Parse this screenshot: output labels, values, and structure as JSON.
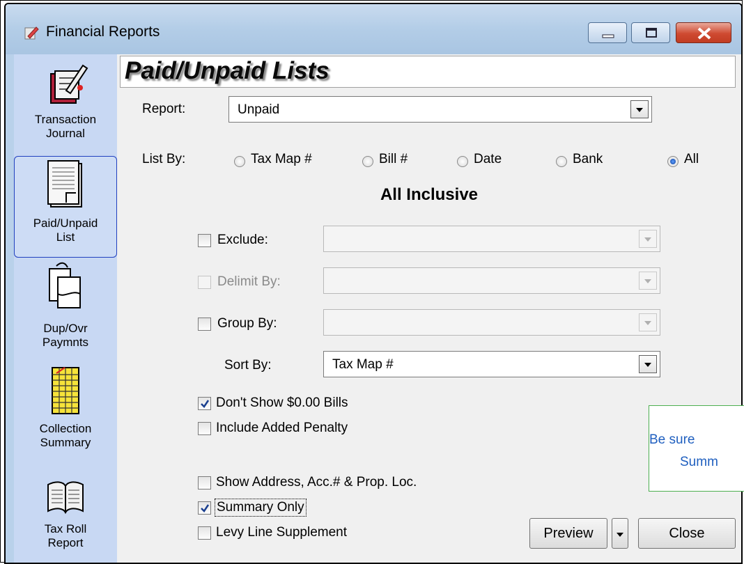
{
  "window": {
    "title": "Financial Reports",
    "controls": [
      "minimize",
      "maximize",
      "close"
    ]
  },
  "sidebar": {
    "items": [
      {
        "label_line1": "Transaction",
        "label_line2": "Journal",
        "icon": "journal-book-icon",
        "selected": false
      },
      {
        "label_line1": "Paid/Unpaid",
        "label_line2": "List",
        "icon": "document-list-icon",
        "selected": true
      },
      {
        "label_line1": "Dup/Ovr",
        "label_line2": "Paymnts",
        "icon": "duplicate-payments-icon",
        "selected": false
      },
      {
        "label_line1": "Collection",
        "label_line2": "Summary",
        "icon": "spreadsheet-icon",
        "selected": false
      },
      {
        "label_line1": "Tax Roll",
        "label_line2": "Report",
        "icon": "open-book-icon",
        "selected": false
      }
    ]
  },
  "main": {
    "heading": "Paid/Unpaid Lists",
    "report_label": "Report:",
    "report_value": "Unpaid",
    "list_by_label": "List By:",
    "list_by_options": [
      {
        "label": "Tax Map #",
        "checked": false
      },
      {
        "label": "Bill #",
        "checked": false
      },
      {
        "label": "Date",
        "checked": false
      },
      {
        "label": "Bank",
        "checked": false
      },
      {
        "label": "All",
        "checked": true
      }
    ],
    "mode_title": "All Inclusive",
    "exclude_label": "Exclude:",
    "exclude_value": "",
    "delimit_label": "Delimit By:",
    "delimit_value": "",
    "group_label": "Group By:",
    "group_value": "",
    "sort_label": "Sort By:",
    "sort_value": "Tax Map #",
    "options": [
      {
        "label": "Don't Show $0.00 Bills",
        "checked": true
      },
      {
        "label": "Include Added Penalty",
        "checked": false
      },
      {
        "label": "Show Address, Acc.# & Prop. Loc.",
        "checked": false
      },
      {
        "label": "Summary Only",
        "checked": true
      },
      {
        "label": "Levy Line Supplement",
        "checked": false
      }
    ],
    "preview_button": "Preview",
    "close_button": "Close"
  },
  "callout": {
    "line1": "Be sure",
    "line2": "Summ"
  },
  "colors": {
    "sidebar_bg": "#c8d8f3",
    "panel_bg": "#f0f0f0",
    "titlebar": "#b3cde7",
    "close_red": "#cf4a31",
    "callout_border": "#4caf50",
    "callout_text": "#1f5fbf"
  }
}
